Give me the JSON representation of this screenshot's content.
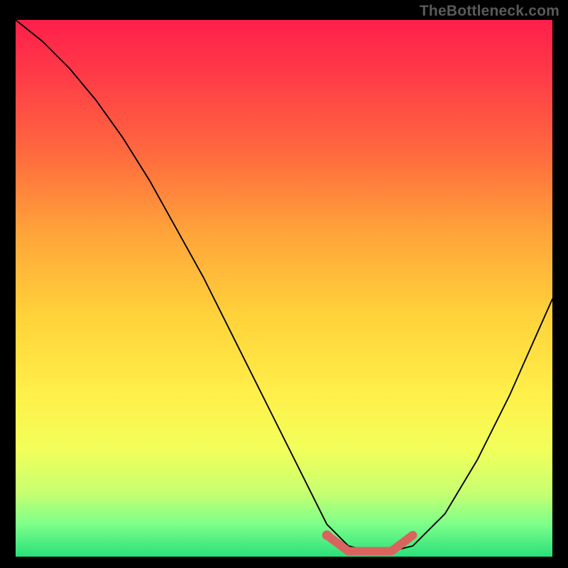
{
  "watermark": "TheBottleneck.com",
  "chart_data": {
    "type": "line",
    "title": "",
    "xlabel": "",
    "ylabel": "",
    "xlim": [
      0,
      100
    ],
    "ylim": [
      0,
      100
    ],
    "series": [
      {
        "name": "curve",
        "x": [
          0,
          5,
          10,
          15,
          20,
          25,
          30,
          35,
          40,
          45,
          50,
          55,
          58,
          62,
          66,
          70,
          74,
          80,
          86,
          92,
          100
        ],
        "y": [
          100,
          96,
          91,
          85,
          78,
          70,
          61,
          52,
          42,
          32,
          22,
          12,
          6,
          2,
          1,
          1,
          2,
          8,
          18,
          30,
          48
        ]
      },
      {
        "name": "highlight",
        "x": [
          58,
          62,
          66,
          70,
          74
        ],
        "y": [
          4,
          1,
          1,
          1,
          4
        ]
      }
    ]
  }
}
